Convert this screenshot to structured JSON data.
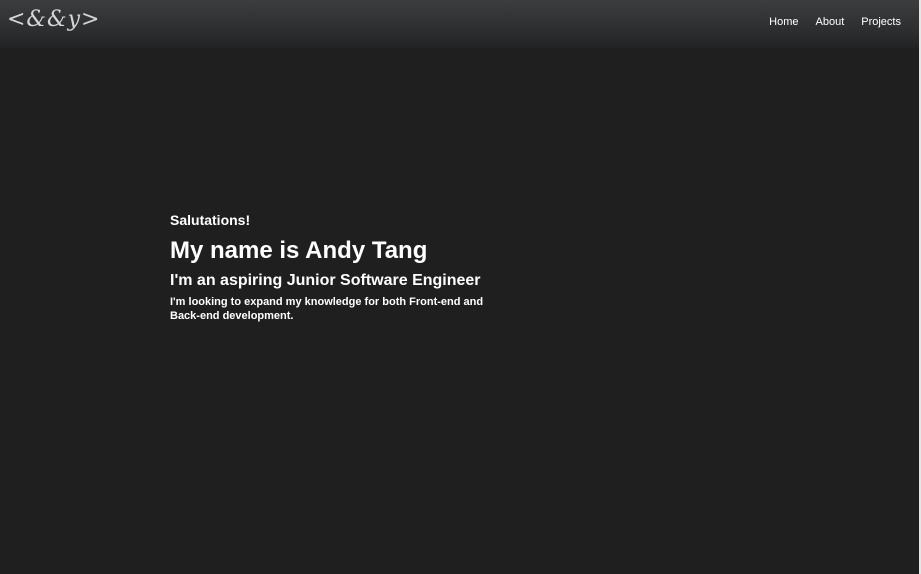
{
  "header": {
    "logo_text": "<&&y>",
    "nav": {
      "home": "Home",
      "about": "About",
      "projects": "Projects"
    }
  },
  "hero": {
    "greeting": "Salutations!",
    "name": "My name is Andy Tang",
    "role": "I'm an aspiring Junior Software Engineer",
    "blurb": "I'm looking to expand my knowledge for both Front-end and Back-end development."
  }
}
